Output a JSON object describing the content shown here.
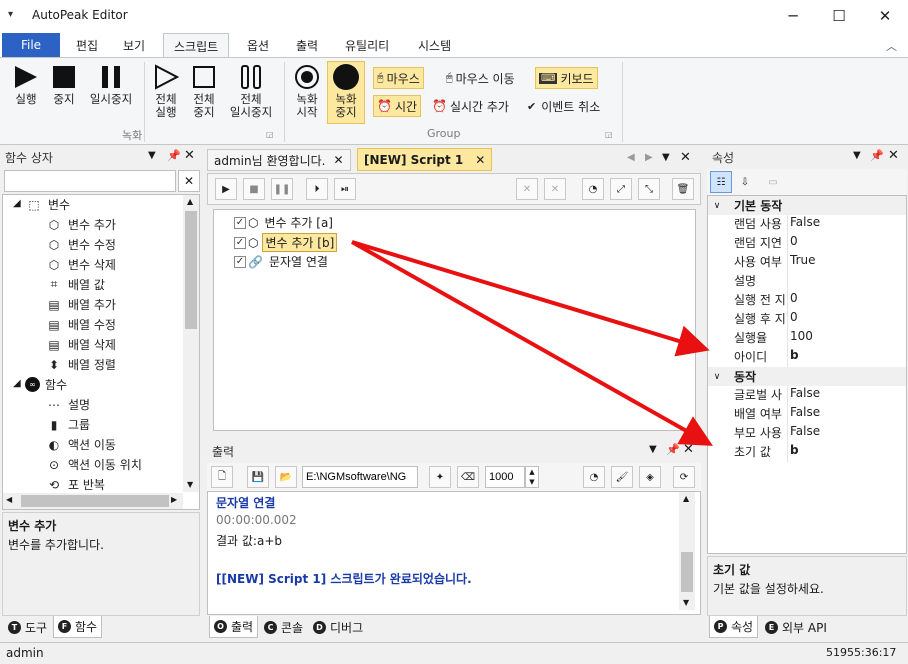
{
  "app": {
    "title": "AutoPeak Editor"
  },
  "ribbon_tabs": [
    "File",
    "편집",
    "보기",
    "스크립트",
    "옵션",
    "출력",
    "유틸리티",
    "시스템"
  ],
  "ribbon": {
    "record_group": {
      "label": "녹화",
      "buttons": [
        {
          "label_1": "실행",
          "label_2": ""
        },
        {
          "label_1": "중지",
          "label_2": ""
        },
        {
          "label_1": "일시중지",
          "label_2": ""
        },
        {
          "label_1": "전체",
          "label_2": "실행"
        },
        {
          "label_1": "전체",
          "label_2": "중지"
        },
        {
          "label_1": "전체",
          "label_2": "일시중지"
        }
      ]
    },
    "group": {
      "label": "Group",
      "record_start": {
        "label_1": "녹화",
        "label_2": "시작"
      },
      "record_stop": {
        "label_1": "녹화",
        "label_2": "중지"
      },
      "mouse": "마우스",
      "mouse_move": "마우스 이동",
      "keyboard": "키보드",
      "time": "시간",
      "realtime_add": "실시간 추가",
      "event_cancel": "이벤트 취소"
    }
  },
  "function_box": {
    "title": "함수 상자",
    "search_value": "",
    "tree": [
      {
        "label": "변수",
        "icon": "variable-group-icon",
        "level": 0
      },
      {
        "label": "변수 추가",
        "icon": "cube-add-icon",
        "level": 1
      },
      {
        "label": "변수 수정",
        "icon": "cube-edit-icon",
        "level": 1
      },
      {
        "label": "변수 삭제",
        "icon": "cube-delete-icon",
        "level": 1
      },
      {
        "label": "배열 값",
        "icon": "array-value-icon",
        "level": 1
      },
      {
        "label": "배열 추가",
        "icon": "array-add-icon",
        "level": 1
      },
      {
        "label": "배열 수정",
        "icon": "array-edit-icon",
        "level": 1
      },
      {
        "label": "배열 삭제",
        "icon": "array-delete-icon",
        "level": 1
      },
      {
        "label": "배열 정렬",
        "icon": "sort-icon",
        "level": 1
      },
      {
        "label": "함수",
        "icon": "function-group-icon",
        "level": 0
      },
      {
        "label": "설명",
        "icon": "comment-icon",
        "level": 1
      },
      {
        "label": "그룹",
        "icon": "group-icon",
        "level": 1
      },
      {
        "label": "액션 이동",
        "icon": "action-move-icon",
        "level": 1
      },
      {
        "label": "액션 이동 위치",
        "icon": "action-target-icon",
        "level": 1
      },
      {
        "label": "포 반복",
        "icon": "loop-icon",
        "level": 1
      }
    ],
    "desc_title": "변수 추가",
    "desc_text": "변수를 추가합니다.",
    "bottom_tabs": [
      "도구",
      "함수"
    ]
  },
  "doc_tabs": [
    "admin님 환영합니다.",
    "[NEW] Script 1"
  ],
  "script_items": [
    {
      "label": "변수 추가 [a]",
      "icon": "cube-icon"
    },
    {
      "label": "변수 추가 [b]",
      "icon": "cube-icon"
    },
    {
      "label": "문자열 연결",
      "icon": "link-icon"
    }
  ],
  "output": {
    "title": "출력",
    "path": "E:\\NGMsoftware\\NG",
    "number": "1000",
    "lines": [
      {
        "text": "문자열 연결",
        "style": "bluebold"
      },
      {
        "text": "00:00:00.002",
        "style": "gray"
      },
      {
        "text": "결과 값:a+b",
        "style": "normal"
      },
      {
        "text": "",
        "style": "normal"
      },
      {
        "text": "[[NEW] Script 1] 스크립트가 완료되었습니다.",
        "style": "bluebold"
      }
    ],
    "bottom_tabs": [
      "출력",
      "콘솔",
      "디버그"
    ]
  },
  "properties": {
    "title": "속성",
    "sections": [
      {
        "name": "기본 동작",
        "rows": [
          {
            "name": "랜덤 사용",
            "value": "False"
          },
          {
            "name": "랜덤 지연",
            "value": "0"
          },
          {
            "name": "사용 여부",
            "value": "True"
          },
          {
            "name": "설명",
            "value": ""
          },
          {
            "name": "실행 전 지",
            "value": "0"
          },
          {
            "name": "실행 후 지",
            "value": "0"
          },
          {
            "name": "실행율",
            "value": "100"
          },
          {
            "name": "아이디",
            "value": "b"
          }
        ]
      },
      {
        "name": "동작",
        "rows": [
          {
            "name": "글로벌 사",
            "value": "False"
          },
          {
            "name": "배열 여부",
            "value": "False"
          },
          {
            "name": "부모 사용",
            "value": "False"
          },
          {
            "name": "초기 값",
            "value": "b"
          }
        ]
      }
    ],
    "desc_title": "초기 값",
    "desc_text": "기본 값을 설정하세요.",
    "bottom_tabs": [
      "속성",
      "외부 API"
    ]
  },
  "status": {
    "user": "admin",
    "time": "51955:36:17"
  },
  "colors": {
    "accent": "#2b62c4",
    "highlight": "#fde8a0",
    "arrow": "#e81010",
    "blue_text": "#1a3aa8"
  }
}
